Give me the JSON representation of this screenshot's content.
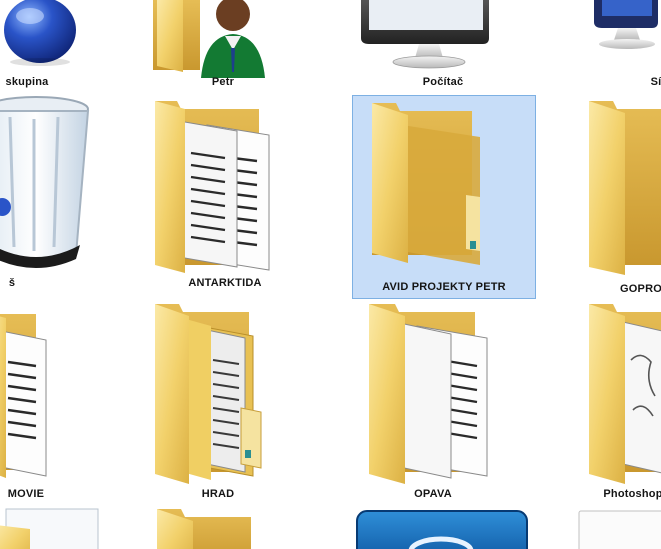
{
  "desktop": {
    "icons": [
      {
        "id": "skupina",
        "label": "skupina",
        "icon": "homegroup-globe-icon"
      },
      {
        "id": "petr",
        "label": "Petr",
        "icon": "user-folder-icon"
      },
      {
        "id": "pocitac",
        "label": "Počítač",
        "icon": "computer-monitor-icon"
      },
      {
        "id": "sit",
        "label": "Sí",
        "icon": "network-icon"
      },
      {
        "id": "kos",
        "label": "š",
        "icon": "recycle-bin-icon"
      },
      {
        "id": "antarktida",
        "label": "ANTARKTIDA",
        "icon": "folder-with-documents-icon"
      },
      {
        "id": "avid",
        "label": "AVID PROJEKTY PETR",
        "icon": "folder-icon",
        "selected": true
      },
      {
        "id": "gopro",
        "label": "GOPRO",
        "icon": "folder-icon"
      },
      {
        "id": "movie",
        "label": "MOVIE",
        "icon": "folder-with-documents-icon"
      },
      {
        "id": "hrad",
        "label": "HRAD",
        "icon": "folder-with-documents-icon"
      },
      {
        "id": "opava",
        "label": "OPAVA",
        "icon": "folder-with-documents-icon"
      },
      {
        "id": "photoshop",
        "label": "Photoshop",
        "icon": "folder-with-documents-icon"
      }
    ],
    "partial_bottom_icons": [
      {
        "id": "bottom-1",
        "icon": "file-icon"
      },
      {
        "id": "bottom-2",
        "icon": "folder-icon"
      },
      {
        "id": "bottom-3",
        "icon": "application-icon"
      },
      {
        "id": "bottom-4",
        "icon": "file-icon"
      }
    ],
    "colors": {
      "folder_front": "#f3d472",
      "folder_back": "#d7aa3a",
      "selection": "#b4d2f5",
      "selection_border": "#7db0e3"
    }
  }
}
